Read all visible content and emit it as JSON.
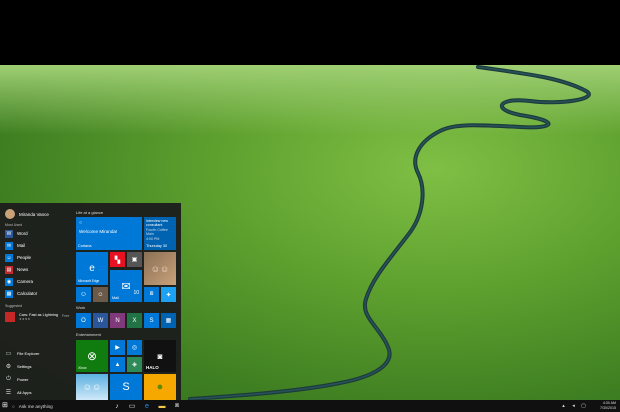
{
  "start_menu": {
    "user_name": "Miranda Vance",
    "most_used_label": "Most Used",
    "most_used": [
      {
        "label": "Word",
        "icon": "word-icon",
        "color": "#2b579a"
      },
      {
        "label": "Mail",
        "icon": "mail-icon",
        "color": "#0078d7"
      },
      {
        "label": "People",
        "icon": "people-icon",
        "color": "#0078d7"
      },
      {
        "label": "News",
        "icon": "news-icon",
        "color": "#c1272d"
      },
      {
        "label": "Camera",
        "icon": "camera-icon",
        "color": "#0078d7"
      },
      {
        "label": "Calculator",
        "icon": "calculator-icon",
        "color": "#0078d7"
      }
    ],
    "suggested_label": "Suggested",
    "suggested": {
      "label": "Cars: Fast as Lightning",
      "badge": "Free",
      "rating": "★★★★"
    },
    "bottom": [
      {
        "label": "File Explorer",
        "icon": "folder-icon"
      },
      {
        "label": "Settings",
        "icon": "gear-icon"
      },
      {
        "label": "Power",
        "icon": "power-icon"
      },
      {
        "label": "All Apps",
        "icon": "all-apps-icon"
      }
    ],
    "sections": {
      "life": "Life at a glance",
      "work": "Work",
      "entertainment": "Entertainment"
    },
    "tiles": {
      "cortana_line1": "Welcome Miranda!",
      "cortana_label": "Cortana",
      "calendar_line1": "Interview new",
      "calendar_line2": "consultant",
      "calendar_line3": "Fourth Coffee Main",
      "calendar_line4": "4:00 PM",
      "calendar_day": "Thursday 30",
      "edge_label": "Microsoft Edge",
      "mail_label": "Mail",
      "mail_count": "10",
      "xbox_label": "Xbox",
      "halo_text": "HALO"
    }
  },
  "taskbar": {
    "search_placeholder": "Ask me anything",
    "time": "4:30 AM",
    "date": "7/30/2015"
  }
}
